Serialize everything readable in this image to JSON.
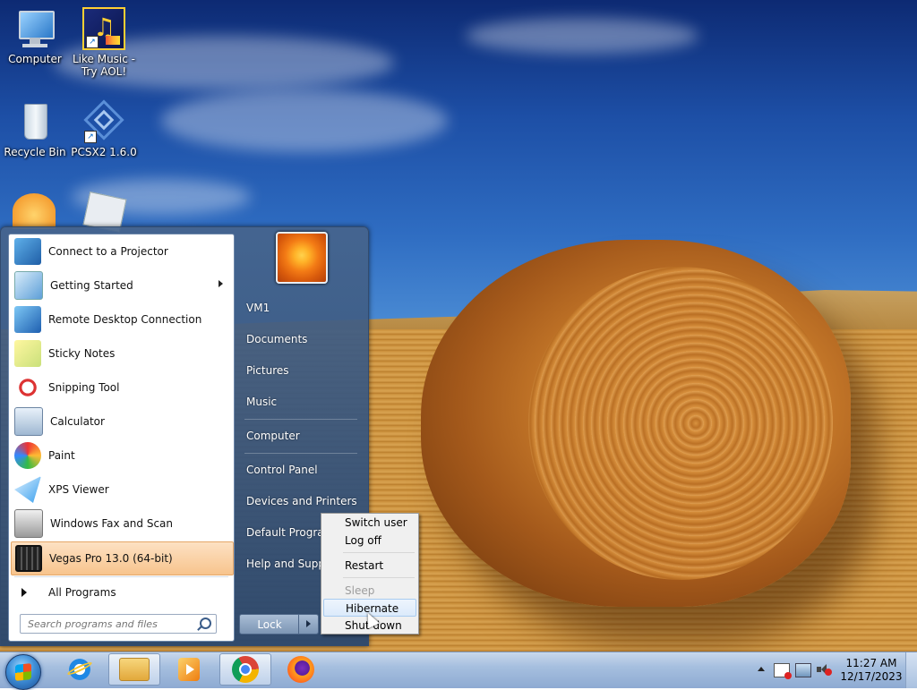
{
  "desktop": {
    "icons": [
      {
        "label": "Computer",
        "icon": "computer-icon"
      },
      {
        "label": "Like Music -\nTry AOL!",
        "icon": "music-note-icon"
      },
      {
        "label": "Recycle Bin",
        "icon": "recycle-bin-icon"
      },
      {
        "label": "PCSX2 1.6.0",
        "icon": "pcsx2-icon"
      }
    ]
  },
  "start_menu": {
    "programs": [
      {
        "label": "Connect to a Projector",
        "icon": "projector-icon"
      },
      {
        "label": "Getting Started",
        "icon": "getting-started-icon",
        "has_submenu": true
      },
      {
        "label": "Remote Desktop Connection",
        "icon": "remote-desktop-icon"
      },
      {
        "label": "Sticky Notes",
        "icon": "sticky-notes-icon"
      },
      {
        "label": "Snipping Tool",
        "icon": "scissors-icon"
      },
      {
        "label": "Calculator",
        "icon": "calculator-icon"
      },
      {
        "label": "Paint",
        "icon": "paint-palette-icon"
      },
      {
        "label": "XPS Viewer",
        "icon": "xps-viewer-icon"
      },
      {
        "label": "Windows Fax and Scan",
        "icon": "fax-icon"
      },
      {
        "label": "Vegas Pro 13.0 (64-bit)",
        "icon": "film-strip-icon",
        "highlighted": true
      }
    ],
    "all_programs": "All Programs",
    "search_placeholder": "Search programs and files",
    "right_items": [
      "VM1",
      "Documents",
      "Pictures",
      "Music",
      "Computer",
      "Control Panel",
      "Devices and Printers",
      "Default Programs",
      "Help and Support"
    ],
    "lock_label": "Lock"
  },
  "power_menu": {
    "items": [
      {
        "label": "Switch user",
        "state": "normal"
      },
      {
        "label": "Log off",
        "state": "normal"
      },
      {
        "label": "Restart",
        "state": "normal"
      },
      {
        "label": "Sleep",
        "state": "disabled"
      },
      {
        "label": "Hibernate",
        "state": "hover"
      },
      {
        "label": "Shut down",
        "state": "normal"
      }
    ]
  },
  "taskbar": {
    "pinned": [
      {
        "name": "internet-explorer-icon",
        "color": "#1e88e5"
      },
      {
        "name": "file-explorer-icon",
        "color": "#e9b949",
        "active": true
      },
      {
        "name": "media-player-icon",
        "color": "#f39c12"
      },
      {
        "name": "chrome-icon",
        "color": "#db4437",
        "active": true
      },
      {
        "name": "firefox-icon",
        "color": "#ff7139"
      }
    ],
    "clock_time": "11:27 AM",
    "clock_date": "12/17/2023"
  }
}
